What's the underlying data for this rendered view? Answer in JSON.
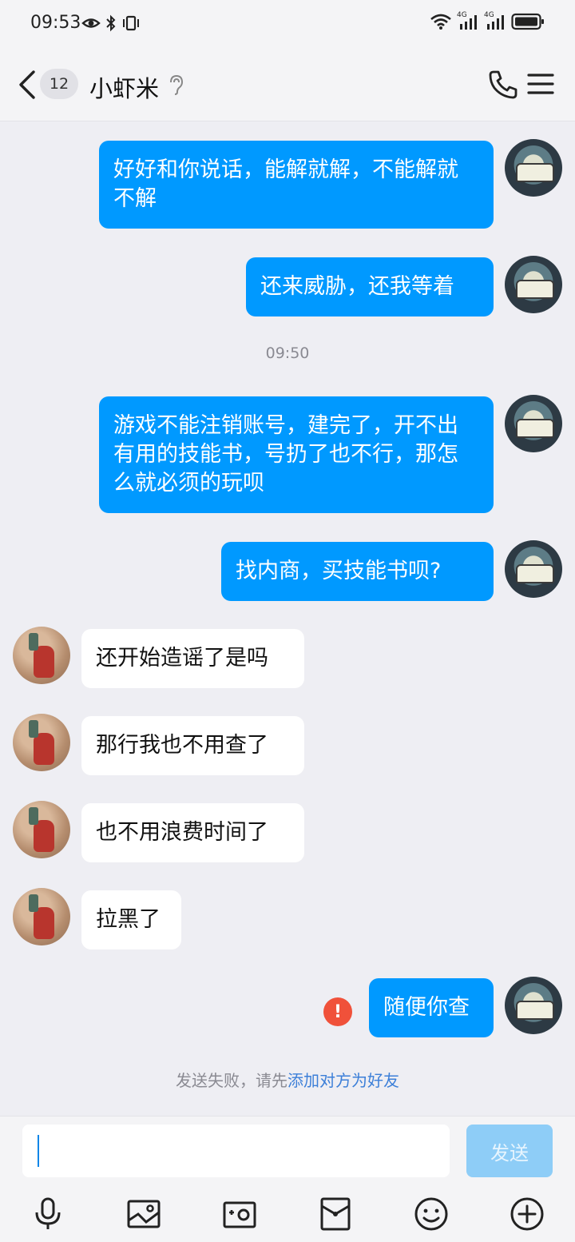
{
  "status_bar": {
    "time": "09:53",
    "network_1": "4G",
    "network_2": "4G"
  },
  "header": {
    "back_badge": "12",
    "contact_name": "小虾米"
  },
  "messages": [
    {
      "from": "me",
      "text": "好好和你说话，能解就解，不能解就不解"
    },
    {
      "from": "me",
      "text": "还来威胁，还我等着"
    },
    {
      "from": "me",
      "text": "游戏不能注销账号，建完了，开不出有用的技能书，号扔了也不行，那怎么就必须的玩呗"
    },
    {
      "from": "me",
      "text": "找内商，买技能书呗?"
    },
    {
      "from": "them",
      "text": "还开始造谣了是吗"
    },
    {
      "from": "them",
      "text": "那行我也不用查了"
    },
    {
      "from": "them",
      "text": "也不用浪费时间了"
    },
    {
      "from": "them",
      "text": "拉黑了"
    },
    {
      "from": "me",
      "text": "随便你查",
      "failed": true
    }
  ],
  "time_separator": "09:50",
  "failure_notice": {
    "prefix": "发送失败，请先",
    "link": "添加对方为好友"
  },
  "input": {
    "value": "",
    "send_label": "发送"
  },
  "toolbar_icons": [
    "microphone-icon",
    "image-icon",
    "camera-icon",
    "red-packet-icon",
    "emoji-icon",
    "plus-icon"
  ],
  "colors": {
    "my_bubble": "#0099ff",
    "their_bubble": "#ffffff",
    "background": "#eeeef3",
    "send_button_disabled": "#8ecdf7",
    "failure_icon": "#f0513a",
    "link": "#3c7fd8"
  }
}
